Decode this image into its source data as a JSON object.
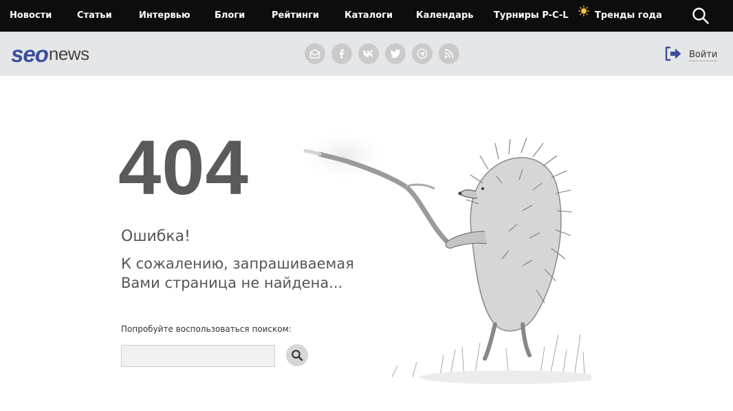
{
  "nav": {
    "items": [
      {
        "label": "Новости"
      },
      {
        "label": "Статьи"
      },
      {
        "label": "Интервью"
      },
      {
        "label": "Блоги"
      },
      {
        "label": "Рейтинги"
      },
      {
        "label": "Каталоги"
      },
      {
        "label": "Календарь"
      },
      {
        "label": "Турниры P-C-L"
      },
      {
        "label": "Тренды года",
        "icon": "sun-icon"
      }
    ],
    "search_icon": "search-icon"
  },
  "header": {
    "logo": {
      "part1": "seo",
      "part2": "news"
    },
    "socials": [
      "mail-icon",
      "facebook-icon",
      "vk-icon",
      "twitter-icon",
      "telegram-icon",
      "rss-icon"
    ],
    "login_label": "Войти",
    "login_icon": "login-icon"
  },
  "error": {
    "code": "404",
    "title": "Ошибка!",
    "message": "К сожалению, запрашиваемая Вами страница не найдена...",
    "search_hint": "Попробуйте воспользоваться поиском:",
    "search_value": "",
    "search_placeholder": "",
    "illustration": "hedgehog-in-the-fog"
  },
  "colors": {
    "nav_bg": "#0d0d0d",
    "header_bg": "#e5e6e8",
    "brand_blue": "#3b4d9c",
    "text_gray": "#5a5a5a"
  }
}
